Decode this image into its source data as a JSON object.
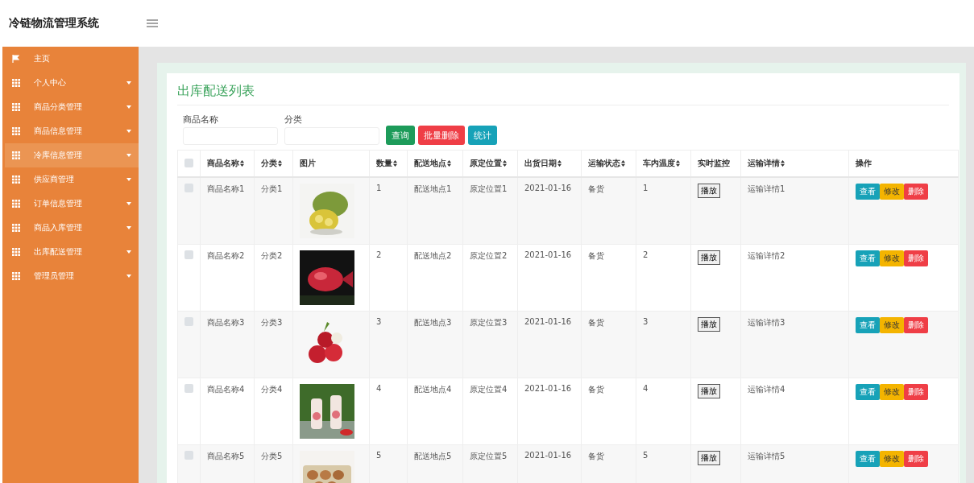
{
  "app_title": "冷链物流管理系统",
  "sidebar": {
    "items": [
      {
        "label": "主页",
        "kind": "home",
        "has_submenu": false,
        "selected": false
      },
      {
        "label": "个人中心",
        "kind": "menu",
        "has_submenu": true,
        "selected": false
      },
      {
        "label": "商品分类管理",
        "kind": "menu",
        "has_submenu": true,
        "selected": false
      },
      {
        "label": "商品信息管理",
        "kind": "menu",
        "has_submenu": true,
        "selected": false
      },
      {
        "label": "冷库信息管理",
        "kind": "menu",
        "has_submenu": true,
        "selected": true
      },
      {
        "label": "供应商管理",
        "kind": "menu",
        "has_submenu": true,
        "selected": false
      },
      {
        "label": "订单信息管理",
        "kind": "menu",
        "has_submenu": true,
        "selected": false
      },
      {
        "label": "商品入库管理",
        "kind": "menu",
        "has_submenu": true,
        "selected": false
      },
      {
        "label": "出库配送管理",
        "kind": "menu",
        "has_submenu": true,
        "selected": false
      },
      {
        "label": "管理员管理",
        "kind": "menu",
        "has_submenu": true,
        "selected": false
      }
    ]
  },
  "page_title": "出库配送列表",
  "filters": [
    {
      "label": "商品名称"
    },
    {
      "label": "分类"
    }
  ],
  "toolbar_buttons": [
    {
      "label": "查询",
      "kind": "search"
    },
    {
      "label": "批量删除",
      "kind": "delete"
    },
    {
      "label": "统计",
      "kind": "stats"
    }
  ],
  "table": {
    "header_checkbox": {
      "checked": false
    },
    "columns": [
      {
        "label": "商品名称",
        "sortable": true
      },
      {
        "label": "分类",
        "sortable": true
      },
      {
        "label": "图片",
        "sortable": false
      },
      {
        "label": "数量",
        "sortable": true
      },
      {
        "label": "配送地点",
        "sortable": true
      },
      {
        "label": "原定位置",
        "sortable": true
      },
      {
        "label": "出货日期",
        "sortable": true
      },
      {
        "label": "运输状态",
        "sortable": true
      },
      {
        "label": "车内温度",
        "sortable": true
      },
      {
        "label": "实时监控",
        "sortable": false
      },
      {
        "label": "运输详情",
        "sortable": true
      },
      {
        "label": "操作",
        "sortable": false
      }
    ],
    "rows": [
      {
        "checked": false,
        "cells": [
          "商品名称1",
          "分类1",
          null,
          "1",
          "配送地点1",
          "原定位置1",
          "2021-01-16",
          "备货",
          "1",
          "播放",
          "运输详情1"
        ],
        "actions": [
          {
            "label": "查看",
            "kind": "view"
          },
          {
            "label": "修改",
            "kind": "edit"
          },
          {
            "label": "删除",
            "kind": "delete"
          }
        ]
      },
      {
        "checked": false,
        "cells": [
          "商品名称2",
          "分类2",
          null,
          "2",
          "配送地点2",
          "原定位置2",
          "2021-01-16",
          "备货",
          "2",
          "播放",
          "运输详情2"
        ],
        "actions": [
          {
            "label": "查看",
            "kind": "view"
          },
          {
            "label": "修改",
            "kind": "edit"
          },
          {
            "label": "删除",
            "kind": "delete"
          }
        ]
      },
      {
        "checked": false,
        "cells": [
          "商品名称3",
          "分类3",
          null,
          "3",
          "配送地点3",
          "原定位置3",
          "2021-01-16",
          "备货",
          "3",
          "播放",
          "运输详情3"
        ],
        "actions": [
          {
            "label": "查看",
            "kind": "view"
          },
          {
            "label": "修改",
            "kind": "edit"
          },
          {
            "label": "删除",
            "kind": "delete"
          }
        ]
      },
      {
        "checked": false,
        "cells": [
          "商品名称4",
          "分类4",
          null,
          "4",
          "配送地点4",
          "原定位置4",
          "2021-01-16",
          "备货",
          "4",
          "播放",
          "运输详情4"
        ],
        "actions": [
          {
            "label": "查看",
            "kind": "view"
          },
          {
            "label": "修改",
            "kind": "edit"
          },
          {
            "label": "删除",
            "kind": "delete"
          }
        ]
      },
      {
        "checked": false,
        "cells": [
          "商品名称5",
          "分类5",
          null,
          "5",
          "配送地点5",
          "原定位置5",
          "2021-01-16",
          "备货",
          "5",
          "播放",
          "运输详情5"
        ],
        "actions": [
          {
            "label": "查看",
            "kind": "view"
          },
          {
            "label": "修改",
            "kind": "edit"
          },
          {
            "label": "删除",
            "kind": "delete"
          }
        ]
      }
    ]
  }
}
